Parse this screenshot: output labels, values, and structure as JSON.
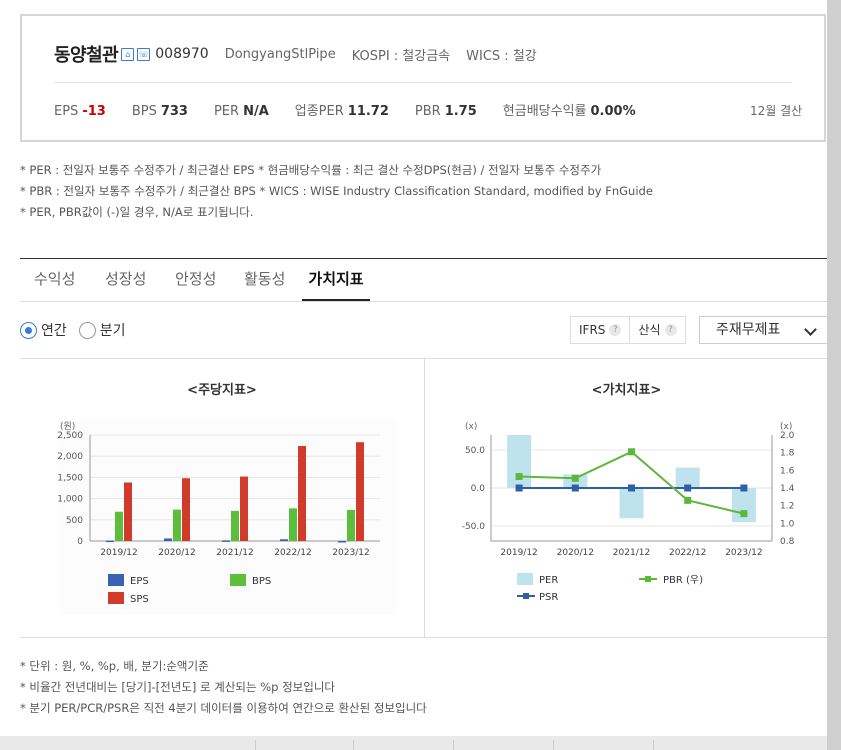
{
  "header": {
    "company_name": "동양철관",
    "badge1": "⌂",
    "badge2": "☏",
    "code": "008970",
    "english_name": "DongyangStlPipe",
    "market": "KOSPI : 철강금속",
    "wics": "WICS : 철강",
    "settlement": "12월 결산",
    "metrics": [
      {
        "label": "EPS",
        "value": "-13"
      },
      {
        "label": "BPS",
        "value": "733"
      },
      {
        "label": "PER",
        "value": "N/A"
      },
      {
        "label": "업종PER",
        "value": "11.72"
      },
      {
        "label": "PBR",
        "value": "1.75"
      },
      {
        "label": "현금배당수익률",
        "value": "0.00%"
      }
    ]
  },
  "notes": [
    "* PER : 전일자 보통주 수정주가 / 최근결산 EPS * 현금배당수익률 : 최근 결산 수정DPS(현금) / 전일자 보통주 수정주가",
    "* PBR : 전일자 보통주 수정주가 / 최근결산 BPS * WICS : WISE Industry Classification Standard, modified by FnGuide",
    "* PER, PBR값이 (-)일 경우, N/A로 표기됩니다."
  ],
  "tabs": [
    "수익성",
    "성장성",
    "안정성",
    "활동성",
    "가치지표"
  ],
  "active_tab": "가치지표",
  "period": {
    "annual": "연간",
    "quarter": "분기",
    "selected": "연간"
  },
  "buttons": {
    "ifrs": "IFRS",
    "calc": "산식",
    "help": "?"
  },
  "statement_select": "주재무제표",
  "footnotes": [
    "* 단위 : 원, %, %p, 배, 분기:순액기준",
    "* 비율간 전년대비는 [당기]-[전년도] 로 계산되는 %p 정보입니다",
    "* 분기 PER/PCR/PSR은 직전 4분기 데이터를 이용하여 연간으로 환산된 정보입니다"
  ],
  "colors": {
    "eps": "#3a62b3",
    "bps": "#5cbf3c",
    "sps": "#d13b2b",
    "per": "#bfe3ec",
    "pbr": "#5cb83a",
    "psr": "#2f5fa8",
    "accent": "#3a7bd5"
  },
  "chart_data": [
    {
      "type": "bar",
      "title": "<주당지표>",
      "ylabel": "(원)",
      "categories": [
        "2019/12",
        "2020/12",
        "2021/12",
        "2022/12",
        "2023/12"
      ],
      "yticks": [
        "0",
        "500",
        "1,000",
        "1,500",
        "2,000",
        "2,500"
      ],
      "ylim": [
        0,
        2500
      ],
      "series": [
        {
          "name": "EPS",
          "values": [
            10,
            60,
            15,
            40,
            -13
          ]
        },
        {
          "name": "BPS",
          "values": [
            690,
            740,
            710,
            770,
            733
          ]
        },
        {
          "name": "SPS",
          "values": [
            1380,
            1480,
            1520,
            2240,
            2330
          ]
        }
      ],
      "legend": "bottom"
    },
    {
      "type": "bar+line",
      "title": "<가치지표>",
      "ylabel_left": "(x)",
      "ylabel_right": "(x)",
      "categories": [
        "2019/12",
        "2020/12",
        "2021/12",
        "2022/12",
        "2023/12"
      ],
      "yticks_left": [
        "-50.0",
        "0.0",
        "50.0"
      ],
      "yticks_right": [
        "0.8",
        "1.0",
        "1.2",
        "1.4",
        "1.6",
        "1.8",
        "2.0"
      ],
      "ylim_left": [
        -70,
        70
      ],
      "ylim_right": [
        0.8,
        2.0
      ],
      "series": [
        {
          "name": "PER",
          "axis": "left",
          "kind": "bar",
          "values": [
            70,
            18,
            -40,
            27,
            -45
          ]
        },
        {
          "name": "PBR (우)",
          "axis": "right",
          "kind": "line",
          "values": [
            1.53,
            1.51,
            1.81,
            1.26,
            1.11
          ]
        },
        {
          "name": "PSR",
          "axis": "left",
          "kind": "line",
          "values": [
            0,
            0,
            0,
            0,
            0
          ]
        }
      ],
      "legend": "bottom"
    }
  ]
}
